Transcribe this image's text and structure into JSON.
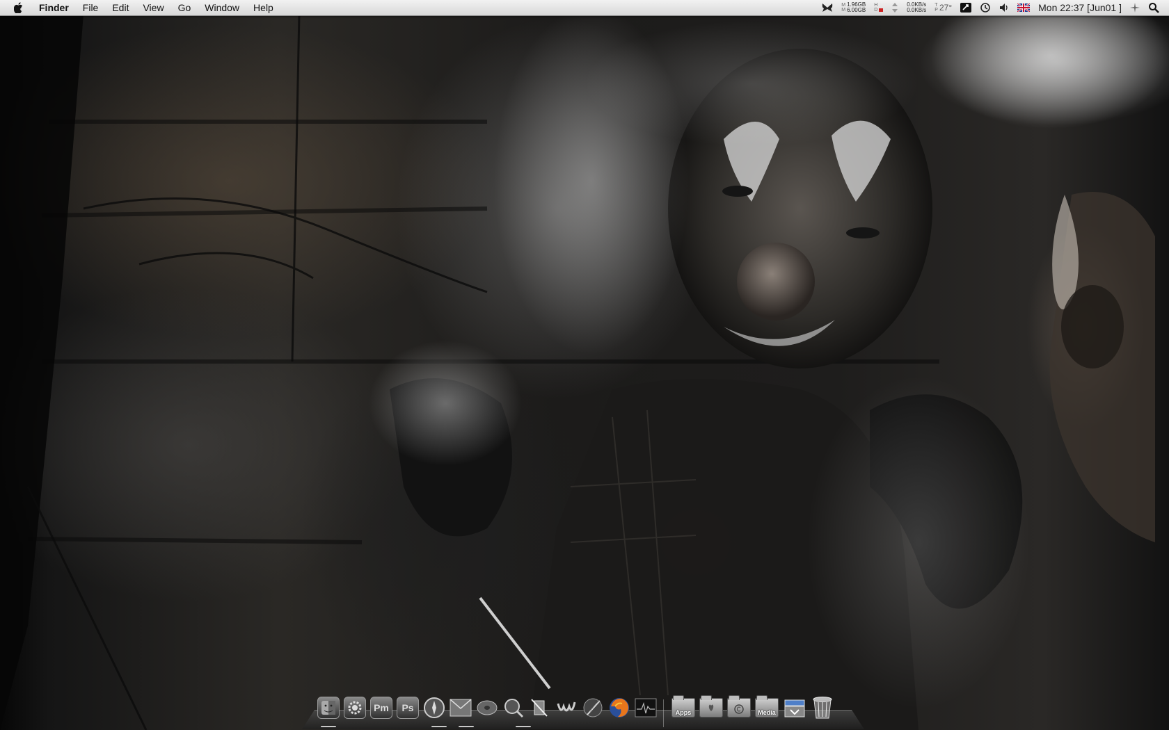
{
  "menubar": {
    "app_name": "Finder",
    "menus": [
      "File",
      "Edit",
      "View",
      "Go",
      "Window",
      "Help"
    ],
    "status": {
      "memory_top": "1.96GB",
      "memory_bottom": "6.00GB",
      "memory_label_top": "M",
      "memory_label_bottom": "M",
      "disk_label_top": "H",
      "disk_label_bottom": "D",
      "net_in": "0.0KB/s",
      "net_out": "0.0KB/s",
      "temp_label_top": "T",
      "temp_label_bottom": "P",
      "temperature": "27°",
      "clock": "Mon 22:37 [Jun01 ]"
    }
  },
  "dock": {
    "items": [
      {
        "name": "finder",
        "label": ""
      },
      {
        "name": "system-preferences",
        "label": ""
      },
      {
        "name": "pixelmator",
        "label": "Pm"
      },
      {
        "name": "photoshop",
        "label": "Ps"
      },
      {
        "name": "safari",
        "label": ""
      },
      {
        "name": "mail",
        "label": ""
      },
      {
        "name": "itunes",
        "label": ""
      },
      {
        "name": "ichat",
        "label": ""
      },
      {
        "name": "script-editor",
        "label": ""
      },
      {
        "name": "textedit",
        "label": ""
      },
      {
        "name": "feather-app",
        "label": ""
      },
      {
        "name": "firefox",
        "label": ""
      },
      {
        "name": "activity-monitor",
        "label": ""
      }
    ],
    "stacks": [
      {
        "name": "apps-folder",
        "label": "Apps"
      },
      {
        "name": "home-folder",
        "label": ""
      },
      {
        "name": "documents-folder",
        "label": ""
      },
      {
        "name": "media-folder",
        "label": "Media"
      },
      {
        "name": "downloads-stack",
        "label": ""
      },
      {
        "name": "trash",
        "label": ""
      }
    ]
  }
}
